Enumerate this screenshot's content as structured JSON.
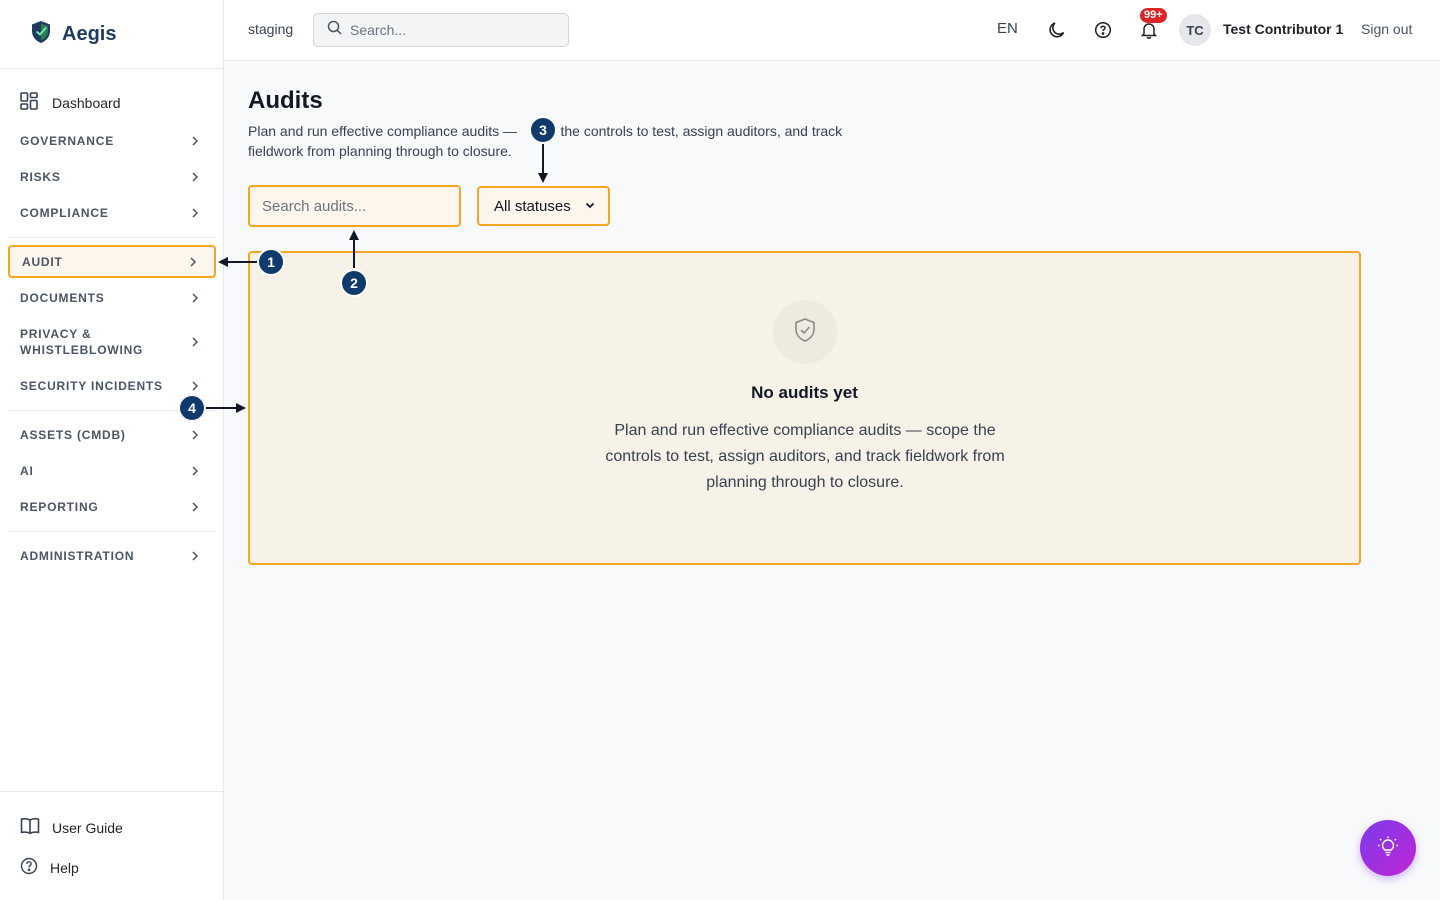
{
  "brand": {
    "name": "Aegis"
  },
  "sidebar": {
    "dashboard": "Dashboard",
    "sections": [
      {
        "label": "GOVERNANCE"
      },
      {
        "label": "RISKS"
      },
      {
        "label": "COMPLIANCE"
      },
      {
        "label": "AUDIT"
      },
      {
        "label": "DOCUMENTS"
      },
      {
        "label_line1": "PRIVACY &",
        "label_line2": "WHISTLEBLOWING"
      },
      {
        "label": "SECURITY INCIDENTS"
      },
      {
        "label": "ASSETS (CMDB)"
      },
      {
        "label": "AI"
      },
      {
        "label": "REPORTING"
      },
      {
        "label": "ADMINISTRATION"
      }
    ],
    "active_section": "AUDIT",
    "bottom": {
      "user_guide": "User Guide",
      "help": "Help"
    }
  },
  "topbar": {
    "environment": "staging",
    "search_placeholder": "Search...",
    "language": "EN",
    "notification_badge": "99+",
    "avatar_initials": "TC",
    "user_name": "Test Contributor 1",
    "sign_out": "Sign out"
  },
  "page": {
    "title": "Audits",
    "subtitle_a": "Plan and run effective compliance audits —",
    "subtitle_b": "pe the controls to test, assign auditors, and track fieldwork from planning through to closure.",
    "search_placeholder": "Search audits...",
    "status_filter": "All statuses",
    "empty_title": "No audits yet",
    "empty_description": "Plan and run effective compliance audits — scope the controls to test, assign auditors, and track fieldwork from planning through to closure."
  },
  "annotations": {
    "m1": "1",
    "m2": "2",
    "m3": "3",
    "m4": "4"
  },
  "colors": {
    "highlight": "#f5a623",
    "marker": "#0f3a6b",
    "brand": "#1e3a5f",
    "badge": "#dc2626",
    "fab_start": "#7c3aed",
    "fab_end": "#c026d3"
  }
}
